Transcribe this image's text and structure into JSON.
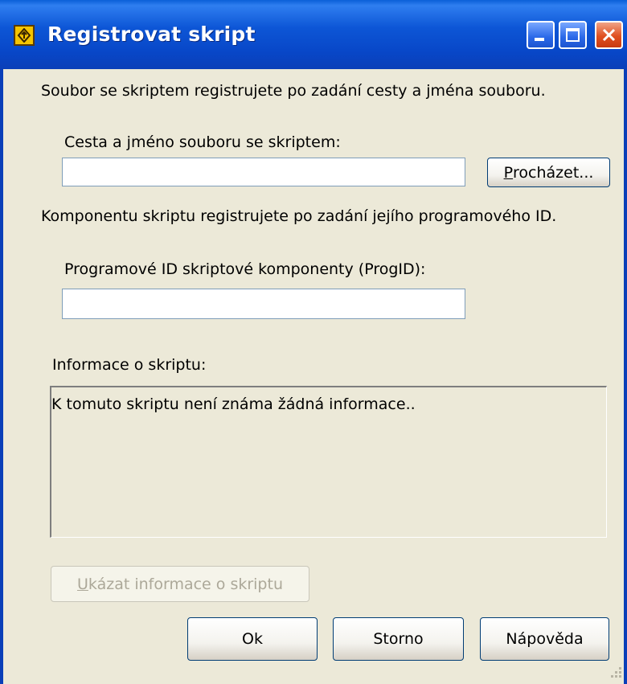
{
  "window": {
    "title": "Registrovat skript",
    "title_icon": "script-register-icon",
    "controls": [
      "minimize-icon",
      "maximize-icon",
      "close-icon"
    ]
  },
  "intro_file": "Soubor se skriptem registrujete po zadání cesty a jména souboru.",
  "file_path": {
    "label": "Cesta a jméno souboru se skriptem:",
    "value": "",
    "browse_hotkey": "P",
    "browse_rest": "rocházet..."
  },
  "intro_component": "Komponentu skriptu registrujete po zadání jejího programového ID.",
  "progid": {
    "label": "Programové ID skriptové komponenty (ProgID):",
    "value": ""
  },
  "info": {
    "label": "Informace o skriptu:",
    "text": "K tomuto skriptu není známa žádná informace..",
    "show_hotkey": "U",
    "show_rest": "kázat informace o skriptu"
  },
  "buttons": {
    "ok": "Ok",
    "cancel": "Storno",
    "help": "Nápověda"
  },
  "colors": {
    "title_bar": "#0a4fd0",
    "dialog_bg": "#ece9d8",
    "close_button": "#e05020"
  }
}
